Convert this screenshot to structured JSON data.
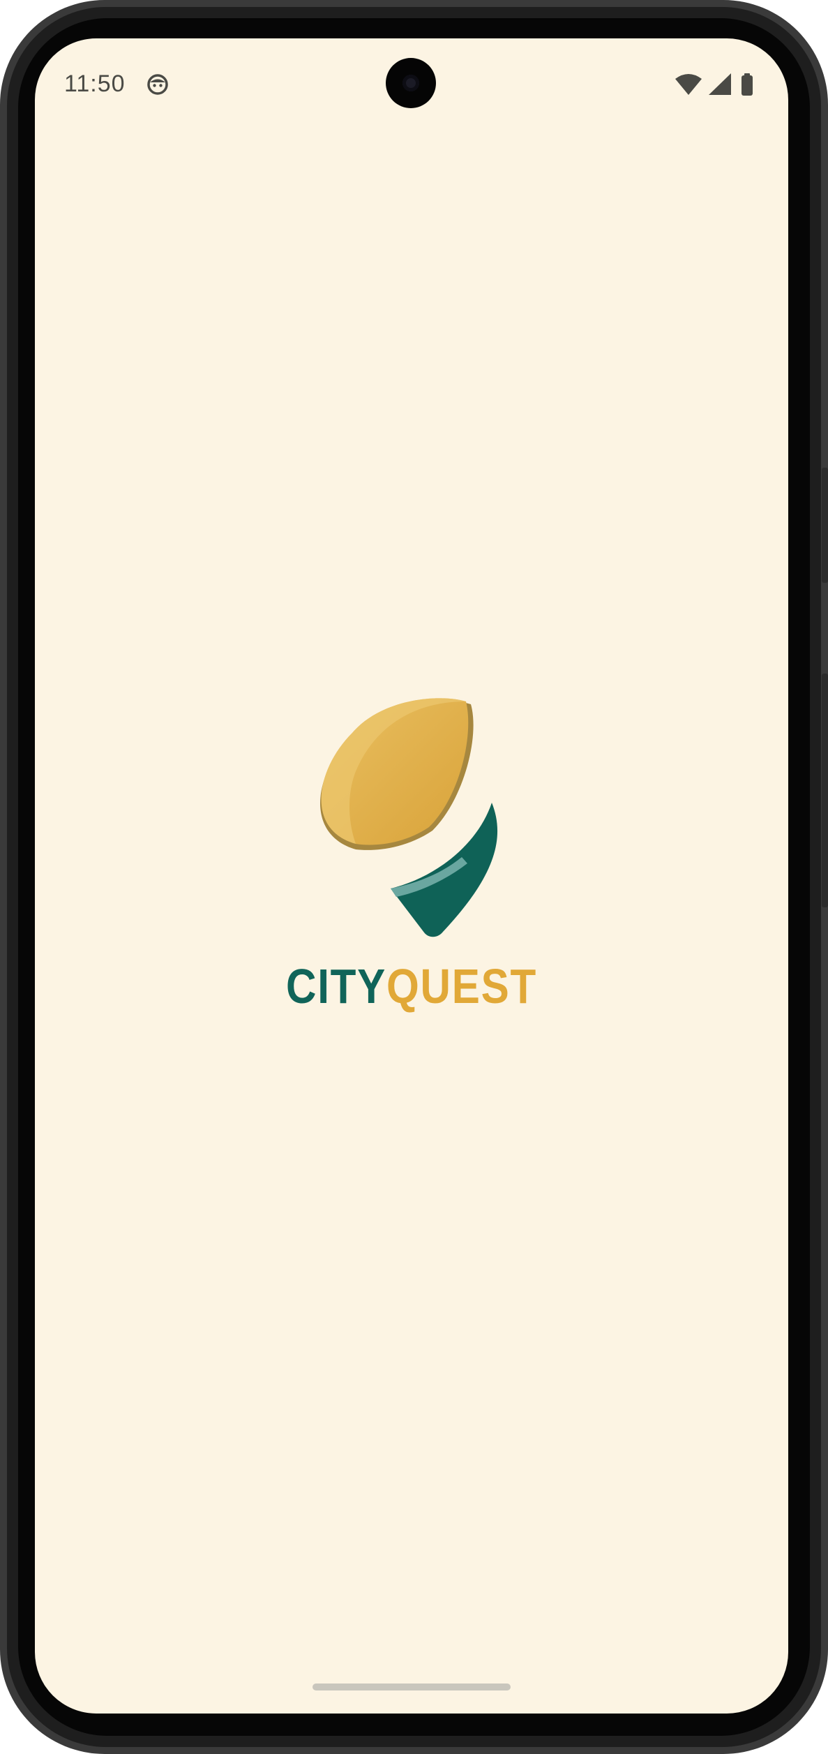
{
  "status_bar": {
    "time": "11:50",
    "notification_icon": "face-icon",
    "icons": [
      "wifi-icon",
      "signal-icon",
      "battery-icon"
    ]
  },
  "app": {
    "logo_icon": "location-pin-logo-icon",
    "name_part1": "CITY",
    "name_part2": "QUEST"
  },
  "colors": {
    "background": "#fcf4e3",
    "brand_green": "#106459",
    "brand_gold": "#e1a837"
  },
  "navigation": {
    "gesture_bar": "home-gesture-handle"
  }
}
